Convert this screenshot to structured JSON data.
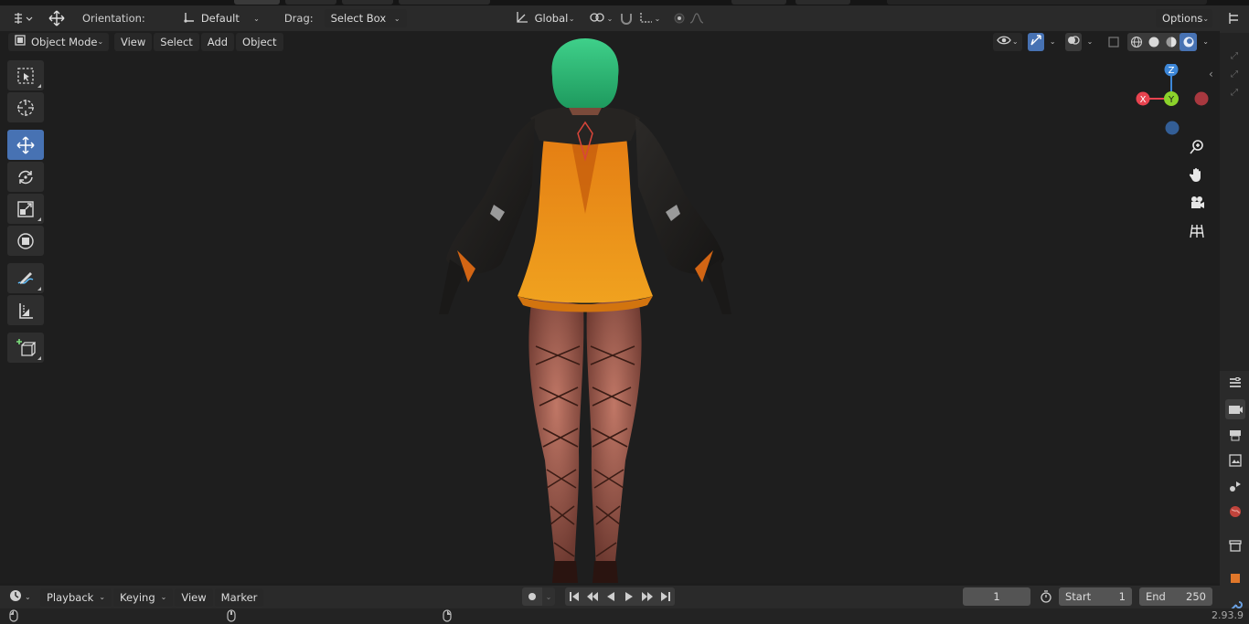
{
  "header": {
    "orientation_label": "Orientation:",
    "orientation_value": "Default",
    "drag_label": "Drag:",
    "drag_value": "Select Box",
    "transform_space": "Global",
    "options_label": "Options"
  },
  "viewport_header": {
    "mode": "Object Mode",
    "menu": [
      "View",
      "Select",
      "Add",
      "Object"
    ]
  },
  "timeline": {
    "menu": [
      "Playback",
      "Keying",
      "View",
      "Marker"
    ],
    "current_frame": "1",
    "start_label": "Start",
    "start_value": "1",
    "end_label": "End",
    "end_value": "250"
  },
  "gizmo": {
    "z": "Z",
    "y": "Y",
    "x": "X"
  },
  "colors": {
    "accent": "#4772b3",
    "x_axis": "#e8434f",
    "y_axis": "#8bd22b",
    "z_axis": "#3d87d8"
  },
  "status": {
    "version": "2.93.9"
  },
  "icons": [
    "editor-type-icon",
    "transform-icon",
    "orientation-icon",
    "snap-icon",
    "proportional-icon",
    "select-box-icon",
    "cursor-icon",
    "move-icon",
    "rotate-icon",
    "scale-icon",
    "transform-tool-icon",
    "annotate-icon",
    "measure-icon",
    "add-cube-icon",
    "zoom-icon",
    "hand-icon",
    "camera-icon",
    "grid-icon"
  ]
}
